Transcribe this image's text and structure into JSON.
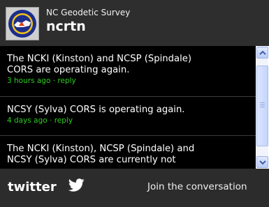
{
  "header": {
    "organization": "NC Geodetic Survey",
    "handle": "ncrtn"
  },
  "tweets": [
    {
      "lines": [
        "The NCKI (Kinston) and NCSP (Spindale)",
        "CORS are operating again."
      ],
      "time": "3 hours ago",
      "separator": " · ",
      "reply": "reply"
    },
    {
      "lines": [
        "NCSY (Sylva) CORS is operating again."
      ],
      "time": "4 days ago",
      "separator": " · ",
      "reply": "reply"
    },
    {
      "lines": [
        "The NCKI (Kinston), NCSP (Spindale) and",
        "NCSY (Sylva) CORS are currently not"
      ]
    }
  ],
  "footer": {
    "logo": "twitter",
    "join": "Join the conversation"
  },
  "colors": {
    "meta_green": "#2ecc1f",
    "background": "#000000",
    "chrome": "#2c2c2c"
  },
  "icons": {
    "avatar": "seal-logo-icon",
    "bird": "twitter-bird-icon",
    "scroll_up": "chevron-up-icon",
    "scroll_down": "chevron-down-icon"
  }
}
